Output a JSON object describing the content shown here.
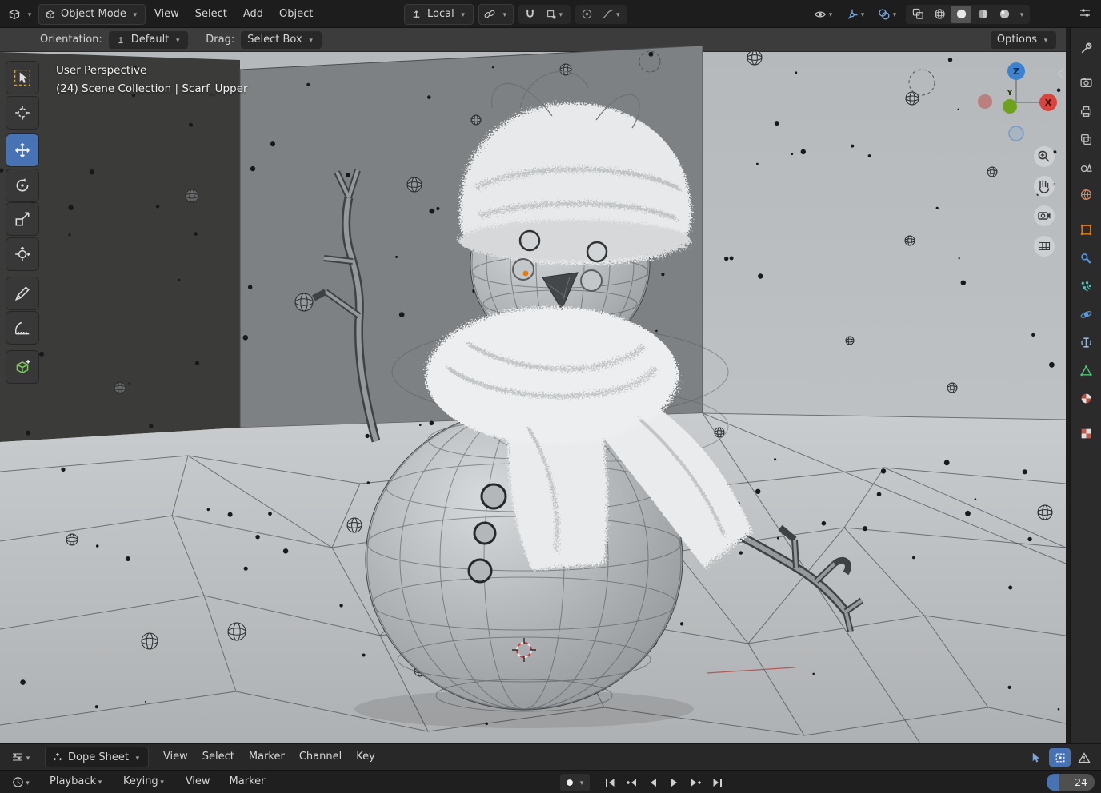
{
  "header": {
    "mode": "Object Mode",
    "menus": [
      "View",
      "Select",
      "Add",
      "Object"
    ],
    "orientation": "Local"
  },
  "tool_settings": {
    "orientation_label": "Orientation:",
    "orientation_value": "Default",
    "drag_label": "Drag:",
    "drag_value": "Select Box",
    "options_label": "Options"
  },
  "viewport": {
    "overlay_line1": "User Perspective",
    "overlay_line2": "(24) Scene Collection | Scarf_Upper",
    "gizmo": {
      "x": "X",
      "y": "Y",
      "z": "Z"
    }
  },
  "dope_sheet": {
    "editor_value": "Dope Sheet",
    "menus": [
      "View",
      "Select",
      "Marker",
      "Channel",
      "Key"
    ]
  },
  "timeline": {
    "playback": "Playback",
    "keying": "Keying",
    "menus": [
      "View",
      "Marker"
    ],
    "frame": "24"
  },
  "colors": {
    "accent": "#4772b3",
    "object_orange": "#e87d0d",
    "axis_x": "#d9453e",
    "axis_y": "#6fa21c",
    "axis_z": "#3b82d0"
  }
}
